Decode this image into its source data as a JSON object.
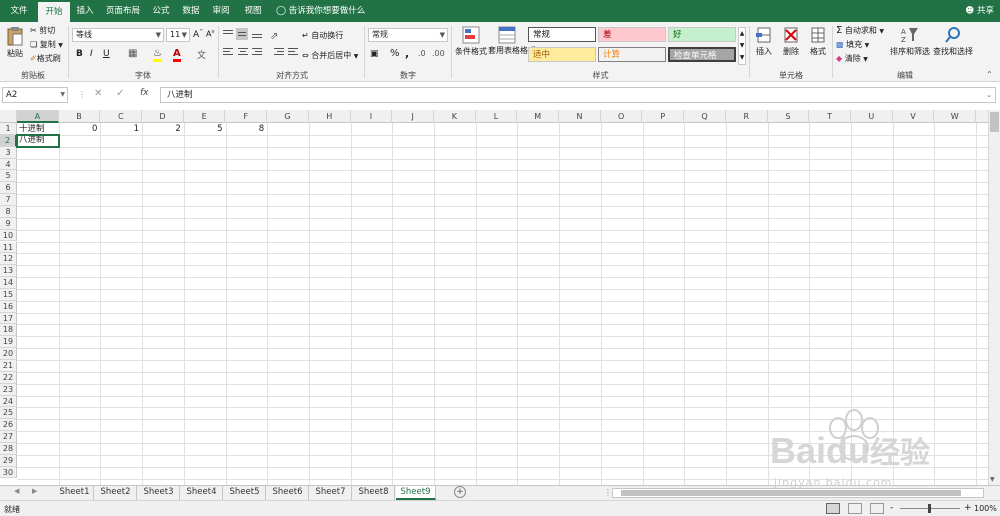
{
  "tabs": [
    "文件",
    "开始",
    "插入",
    "页面布局",
    "公式",
    "数据",
    "审阅",
    "视图"
  ],
  "tell_me": "告诉我你想要做什么",
  "share": "共享",
  "clipboard": {
    "paste": "粘贴",
    "cut": "剪切",
    "copy": "复制",
    "format_painter": "格式刷",
    "label": "剪贴板"
  },
  "font": {
    "name": "等线",
    "size": "11",
    "label": "字体",
    "bold": "B",
    "italic": "I",
    "underline": "U"
  },
  "alignment": {
    "wrap": "自动换行",
    "merge": "合并后居中",
    "label": "对齐方式"
  },
  "number": {
    "format": "常规",
    "percent": "%",
    "comma": ",",
    "label": "数字"
  },
  "styles": {
    "conditional": "条件格式",
    "table": "套用表格格式",
    "normal": "常规",
    "bad": "差",
    "good": "好",
    "neutral": "适中",
    "calc": "计算",
    "check": "检查单元格",
    "label": "样式"
  },
  "cells": {
    "insert": "插入",
    "delete": "删除",
    "format": "格式",
    "label": "单元格"
  },
  "editing": {
    "autosum": "自动求和",
    "fill": "填充",
    "clear": "清除",
    "sort": "排序和筛选",
    "find": "查找和选择",
    "label": "编辑"
  },
  "formula_bar": {
    "name_box": "A2",
    "fx": "fx",
    "content": "八进制"
  },
  "columns": [
    "A",
    "B",
    "C",
    "D",
    "E",
    "F",
    "G",
    "H",
    "I",
    "J",
    "K",
    "L",
    "M",
    "N",
    "O",
    "P",
    "Q",
    "R",
    "S",
    "T",
    "U",
    "V",
    "W"
  ],
  "rows": [
    "1",
    "2",
    "3",
    "4",
    "5",
    "6",
    "7",
    "8",
    "9",
    "10",
    "11",
    "12",
    "13",
    "14",
    "15",
    "16",
    "17",
    "18",
    "19",
    "20",
    "21",
    "22",
    "23",
    "24",
    "25",
    "26",
    "27",
    "28",
    "29",
    "30"
  ],
  "cells_data": {
    "A1": "十进制",
    "B1": "0",
    "C1": "1",
    "D1": "2",
    "E1": "5",
    "F1": "8",
    "A2": "八进制"
  },
  "sheets": [
    "Sheet1",
    "Sheet2",
    "Sheet3",
    "Sheet4",
    "Sheet5",
    "Sheet6",
    "Sheet7",
    "Sheet8",
    "Sheet9"
  ],
  "active_sheet": "Sheet9",
  "status": {
    "ready": "就绪",
    "zoom": "100%",
    "minus": "-",
    "plus": "+"
  },
  "watermark": {
    "brand": "Baidu",
    "suffix": "经验",
    "url": "jingyan.baidu.com"
  },
  "colors": {
    "excel_green": "#217346"
  }
}
